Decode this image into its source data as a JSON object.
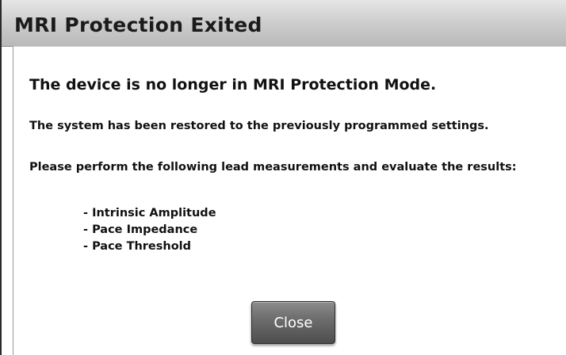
{
  "dialog": {
    "title": "MRI Protection Exited",
    "heading": "The device is no longer in MRI Protection Mode.",
    "paragraph_restored": "The system has been restored to the previously programmed settings.",
    "paragraph_instructions": "Please perform the following lead measurements and evaluate the results:",
    "measurements": [
      "- Intrinsic Amplitude",
      "- Pace Impedance",
      "- Pace Threshold"
    ],
    "close_label": "Close"
  }
}
